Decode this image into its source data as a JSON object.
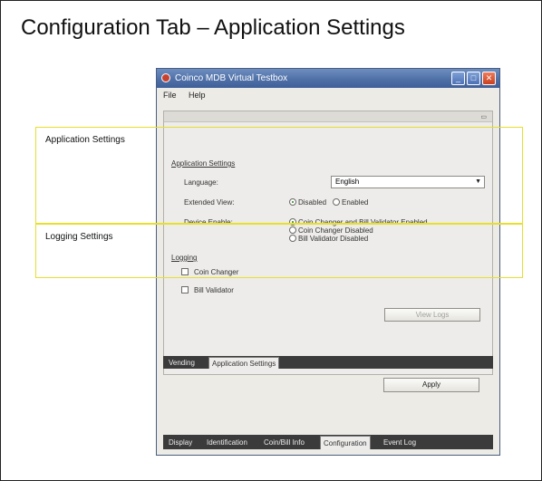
{
  "slide_title": "Configuration Tab – Application Settings",
  "window": {
    "title": "Coinco MDB Virtual Testbox",
    "menu": [
      "File",
      "Help"
    ],
    "buttons": {
      "minimize": "_",
      "maximize": "□",
      "close": "✕"
    }
  },
  "application_settings": {
    "heading": "Application Settings",
    "language_label": "Language:",
    "language_value": "English",
    "extended_view_label": "Extended View:",
    "extended_view_options": [
      "Disabled",
      "Enabled"
    ],
    "extended_view_selected": "Disabled",
    "device_enable_label": "Device Enable:",
    "device_enable_options": [
      "Coin Changer and Bill Validator Enabled",
      "Coin Changer Disabled",
      "Bill Validator Disabled"
    ],
    "device_enable_selected": "Coin Changer and Bill Validator Enabled"
  },
  "logging": {
    "heading": "Logging",
    "coin_changer": "Coin Changer",
    "bill_validator": "Bill Validator",
    "view_logs": "View Logs"
  },
  "inner_tabs": [
    "Vending",
    "Application Settings"
  ],
  "inner_tab_active": "Application Settings",
  "apply_label": "Apply",
  "bottom_tabs": [
    "Display",
    "Identification",
    "Coin/Bill Info",
    "Configuration",
    "Event Log"
  ],
  "bottom_tab_active": "Configuration",
  "callouts": {
    "application": "Application Settings",
    "logging": "Logging Settings"
  },
  "colors": {
    "callout": "#e8df2c",
    "titlebar": "#4d6ea6",
    "tabstrip": "#3b3b3b"
  }
}
